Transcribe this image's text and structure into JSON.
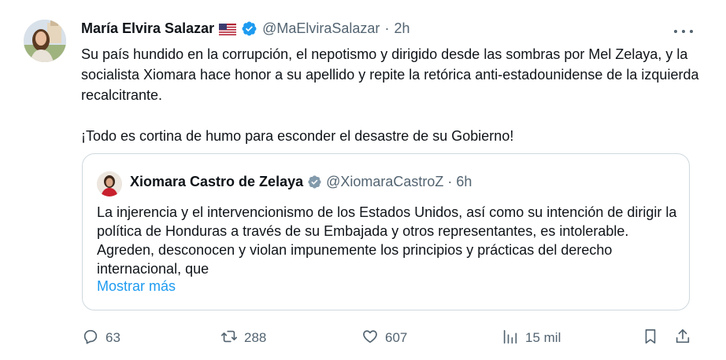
{
  "tweet": {
    "author_name": "María Elvira Salazar",
    "author_handle": "@MaElviraSalazar",
    "separator": "·",
    "time": "2h",
    "text_paragraphs": [
      "Su país hundido en la corrupción, el nepotismo y dirigido desde las sombras por Mel Zelaya, y la socialista Xiomara hace honor a su apellido y repite la retórica anti-estadounidense de la izquierda recalcitrante.",
      "¡Todo es cortina de humo para esconder el desastre de su Gobierno!"
    ]
  },
  "quoted_tweet": {
    "author_name": "Xiomara Castro de Zelaya",
    "author_handle": "@XiomaraCastroZ",
    "separator": "·",
    "time": "6h",
    "text": "La injerencia y el intervencionismo de los Estados Unidos, así como su intención de dirigir la política de Honduras a través de su Embajada y otros representantes, es intolerable. Agreden, desconocen y violan impunemente los principios y prácticas del derecho internacional, que",
    "show_more_label": "Mostrar más"
  },
  "actions": {
    "replies": "63",
    "reposts": "288",
    "likes": "607",
    "views": "15 mil"
  },
  "colors": {
    "text": "#0f1419",
    "secondary": "#536471",
    "link": "#1d9bf0",
    "verified_blue": "#1d9bf0",
    "verified_gray": "#829aab",
    "border": "#cfd9de"
  },
  "icons": {
    "more": "more-horizontal-icon",
    "verified": "verified-badge-icon",
    "flag": "us-flag-icon",
    "reply": "reply-icon",
    "repost": "repost-icon",
    "like": "heart-icon",
    "views": "views-chart-icon",
    "bookmark": "bookmark-icon",
    "share": "share-icon"
  }
}
